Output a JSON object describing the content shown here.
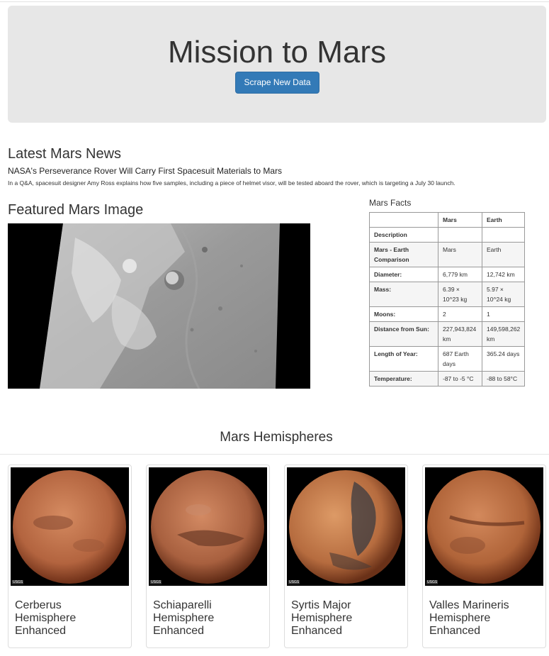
{
  "header": {
    "title": "Mission to Mars",
    "scrape_button": "Scrape New Data"
  },
  "news": {
    "section_title": "Latest Mars News",
    "headline": "NASA's Perseverance Rover Will Carry First Spacesuit Materials to Mars",
    "paragraph": "In a Q&A, spacesuit designer Amy Ross explains how five samples, including a piece of helmet visor, will be tested aboard the rover, which is targeting a July 30 launch."
  },
  "featured": {
    "section_title": "Featured Mars Image"
  },
  "facts": {
    "title": "Mars Facts",
    "columns": [
      "",
      "Mars",
      "Earth"
    ],
    "rows": [
      [
        "Description",
        "",
        ""
      ],
      [
        "Mars - Earth Comparison",
        "Mars",
        "Earth"
      ],
      [
        "Diameter:",
        "6,779 km",
        "12,742 km"
      ],
      [
        "Mass:",
        "6.39 × 10^23 kg",
        "5.97 × 10^24 kg"
      ],
      [
        "Moons:",
        "2",
        "1"
      ],
      [
        "Distance from Sun:",
        "227,943,824 km",
        "149,598,262 km"
      ],
      [
        "Length of Year:",
        "687 Earth days",
        "365.24 days"
      ],
      [
        "Temperature:",
        "-87 to -5 °C",
        "-88 to 58°C"
      ]
    ]
  },
  "hemispheres": {
    "section_title": "Mars Hemispheres",
    "items": [
      {
        "title": "Cerberus Hemisphere Enhanced",
        "image": "cerberus-hemisphere-image"
      },
      {
        "title": "Schiaparelli Hemisphere Enhanced",
        "image": "schiaparelli-hemisphere-image"
      },
      {
        "title": "Syrtis Major Hemisphere Enhanced",
        "image": "syrtis-major-hemisphere-image"
      },
      {
        "title": "Valles Marineris Hemisphere Enhanced",
        "image": "valles-marineris-hemisphere-image"
      }
    ],
    "image_badge": "USGS"
  },
  "colors": {
    "jumbotron_bg": "#e7e7e7",
    "button_bg": "#337ab7",
    "text": "#333333"
  }
}
